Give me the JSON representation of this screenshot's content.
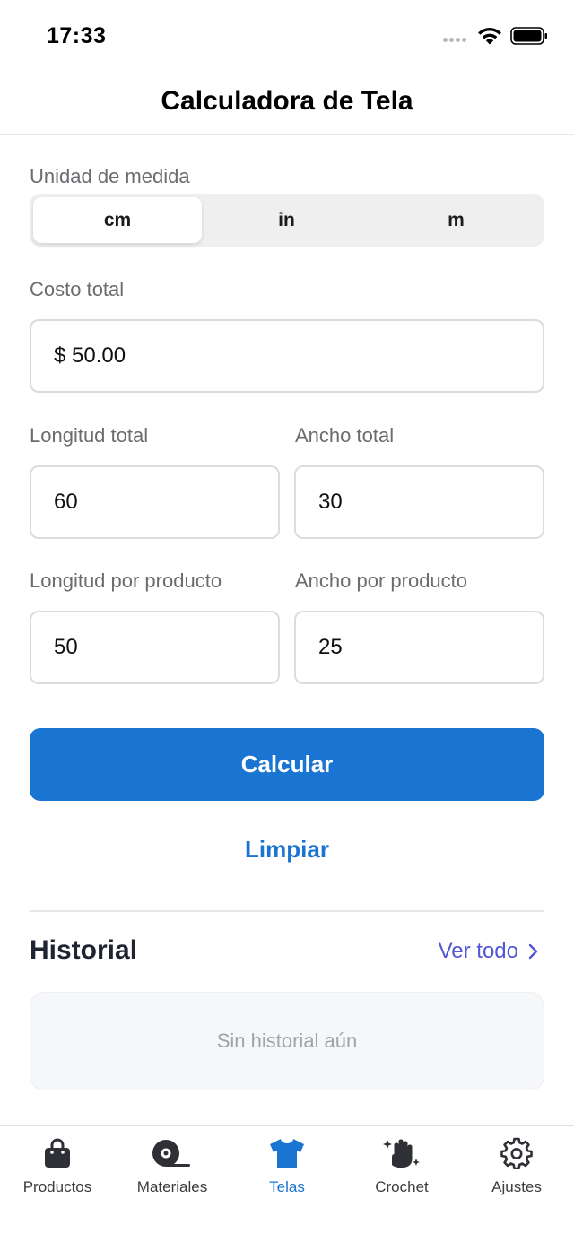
{
  "status_bar": {
    "time": "17:33"
  },
  "header": {
    "title": "Calculadora de Tela"
  },
  "unit": {
    "label": "Unidad de medida",
    "options": [
      "cm",
      "in",
      "m"
    ],
    "selected": "cm"
  },
  "cost": {
    "label": "Costo total",
    "value": "$ 50.00"
  },
  "length_total": {
    "label": "Longitud total",
    "value": "60"
  },
  "width_total": {
    "label": "Ancho total",
    "value": "30"
  },
  "length_product": {
    "label": "Longitud por producto",
    "value": "50"
  },
  "width_product": {
    "label": "Ancho por producto",
    "value": "25"
  },
  "actions": {
    "calculate_label": "Calcular",
    "clear_label": "Limpiar"
  },
  "history": {
    "title": "Historial",
    "see_all_label": "Ver todo",
    "empty_text": "Sin historial aún"
  },
  "tabs": [
    {
      "label": "Productos",
      "icon": "shopping-bag-icon",
      "active": false
    },
    {
      "label": "Materiales",
      "icon": "fabric-roll-icon",
      "active": false
    },
    {
      "label": "Telas",
      "icon": "tshirt-icon",
      "active": true
    },
    {
      "label": "Crochet",
      "icon": "hand-sparkles-icon",
      "active": false
    },
    {
      "label": "Ajustes",
      "icon": "gear-icon",
      "active": false
    }
  ],
  "colors": {
    "primary": "#1a74d2",
    "link": "#5157d6",
    "tab_inactive_icon": "#2e3035",
    "text_secondary": "#6b6b70"
  }
}
